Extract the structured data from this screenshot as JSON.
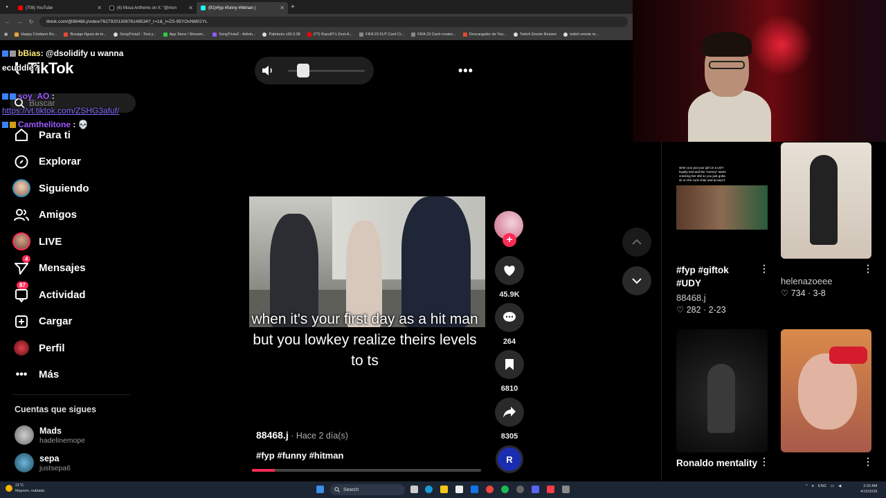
{
  "browser": {
    "tabs": [
      {
        "label": "(708) YouTube",
        "color": "#ff0000"
      },
      {
        "label": "(6) Musa Anthems on X: \"@mon",
        "color": "#000000"
      },
      {
        "label": "(91)#fyp #funny #hitman |",
        "color": "#25f4ee"
      }
    ],
    "new_tab": "+",
    "url": "tiktok.com/@88468.j/video/7627920130676149534?_r=1&_t=ZS-95YOvNM01YL",
    "bookmarks": [
      "Happy Cristiano Ro...",
      "Buraigo figura de to...",
      "SongTrivia2 - Test y...",
      "App Store / Streami...",
      "SongTrivia2 - Adivin...",
      "Paletools v26.0.28",
      "(77) Razo87's Zest-A...",
      "FIFA 23 FUT Card Cr...",
      "FIFA 23 Card creator...",
      "Descargador de You...",
      "Twitch Emote Resizer",
      "twitch emote re..."
    ]
  },
  "chat": [
    {
      "user": "bBias",
      "text": ": @dsolidify u wanna ecuddle?"
    },
    {
      "user": "soy_AO",
      "text": " :"
    },
    {
      "link": "https://vt.tiktok.com/ZSHG3afuf/"
    },
    {
      "user": "Camthelitone",
      "text": " : 💀"
    }
  ],
  "tiktok": {
    "logo": "TikTok",
    "search_placeholder": "Buscar",
    "nav": [
      {
        "label": "Para ti",
        "icon": "home-icon"
      },
      {
        "label": "Explorar",
        "icon": "compass-icon"
      },
      {
        "label": "Siguiendo",
        "icon": "avatar"
      },
      {
        "label": "Amigos",
        "icon": "friends-icon"
      },
      {
        "label": "LIVE",
        "icon": "avatar"
      },
      {
        "label": "Mensajes",
        "icon": "send-icon",
        "badge": "4"
      },
      {
        "label": "Actividad",
        "icon": "inbox-icon",
        "badge": "87"
      },
      {
        "label": "Cargar",
        "icon": "plus-square-icon"
      },
      {
        "label": "Perfil",
        "icon": "avatar"
      },
      {
        "label": "Más",
        "icon": "more-icon"
      }
    ],
    "following_title": "Cuentas que sigues",
    "following": [
      {
        "name": "Mads",
        "handle": "hadelinemope"
      },
      {
        "name": "sepa",
        "handle": "justsepa6"
      }
    ]
  },
  "video": {
    "volume_level": 0.2,
    "caption": "when it's your first day as a hit man but you lowkey realize theirs levels to ts",
    "author": "88468.j",
    "posted": " · Hace 2 día(s)",
    "tags": "#fyp #funny #hitman",
    "progress": 0.1,
    "likes": "45.9K",
    "comments": "264",
    "saves": "6810",
    "shares": "8305"
  },
  "cards": [
    {
      "title": "#fyp #giftok #UDY",
      "author": "88468.j",
      "likes": "282",
      "date": "2-23",
      "thumb_text": "when you put your girl on a UDY loyalty test and the \"enemy\" starts cracking her shit so you just gotta sit on the cuck chair and accept it"
    },
    {
      "title": "",
      "author": "helenazoeee",
      "likes": "734",
      "date": "3-8"
    },
    {
      "title": "Ronaldo mentality",
      "author": "",
      "likes": "",
      "date": ""
    },
    {
      "title": "",
      "author": "",
      "likes": "",
      "date": ""
    }
  ],
  "taskbar": {
    "weather_temp": "21°C",
    "weather_desc": "Mayorm. nublado",
    "search": "Search",
    "lang": "ENG",
    "time": "2:03 AM",
    "date": "4/15/2026"
  },
  "colors": {
    "accent": "#fe2c55",
    "tiktok_bg": "#000000",
    "taskbar": "#1c2533"
  }
}
